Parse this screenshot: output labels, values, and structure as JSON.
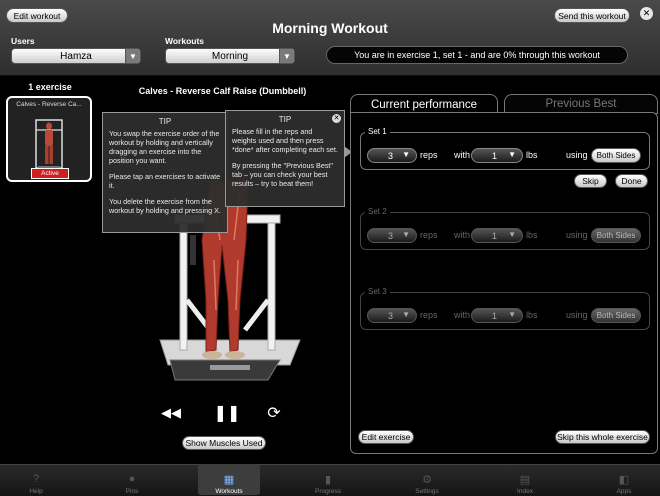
{
  "header": {
    "edit_workout": "Edit workout",
    "title": "Morning Workout",
    "send_workout": "Send this workout",
    "users_label": "Users",
    "user_value": "Hamza",
    "workouts_label": "Workouts",
    "workout_value": "Morning",
    "status": "You are in exercise 1, set 1 - and are 0% through this workout"
  },
  "left": {
    "count_label": "1 exercise",
    "thumb_title": "Calves - Reverse Ca...",
    "thumb_badge": "Active"
  },
  "exercise": {
    "title": "Calves - Reverse Calf Raise (Dumbbell)",
    "show_muscles": "Show Muscles Used"
  },
  "tip1": {
    "title": "TIP",
    "p1": "You swap the exercise order of the workout by holding and vertically dragging an exercise into the position you want.",
    "p2": "Please tap an exercises to activate it.",
    "p3": "You delete the exercise from the workout by holding and pressing X."
  },
  "tip2": {
    "title": "TIP",
    "p1": "Please fill in the reps and weights used and then press *done* after completing each set.",
    "p2": "By pressing the \"Previous Best\" tab – you can check your best results – try to beat them!"
  },
  "tabs": {
    "current": "Current performance",
    "previous": "Previous Best"
  },
  "sets": [
    {
      "label": "Set 1",
      "reps": "3",
      "weight": "1",
      "side": "Both Sides"
    },
    {
      "label": "Set 2",
      "reps": "3",
      "weight": "1",
      "side": "Both Sides"
    },
    {
      "label": "Set 3",
      "reps": "3",
      "weight": "1",
      "side": "Both Sides"
    }
  ],
  "set_words": {
    "reps": "reps",
    "with": "with",
    "lbs": "lbs",
    "using": "using"
  },
  "set_buttons": {
    "skip": "Skip",
    "done": "Done"
  },
  "panel_buttons": {
    "edit": "Edit exercise",
    "skip_all": "Skip this whole exercise"
  },
  "tabbar": [
    {
      "label": "Help",
      "icon": "help-icon"
    },
    {
      "label": "Pins",
      "icon": "pin-icon"
    },
    {
      "label": "Workouts",
      "icon": "calendar-icon"
    },
    {
      "label": "Progress",
      "icon": "bar-chart-icon"
    },
    {
      "label": "Settings",
      "icon": "gear-icon"
    },
    {
      "label": "Index",
      "icon": "index-icon"
    },
    {
      "label": "Apps",
      "icon": "apps-icon"
    }
  ],
  "colors": {
    "accent": "#7fb2ff",
    "badge": "#cc1f1f"
  }
}
